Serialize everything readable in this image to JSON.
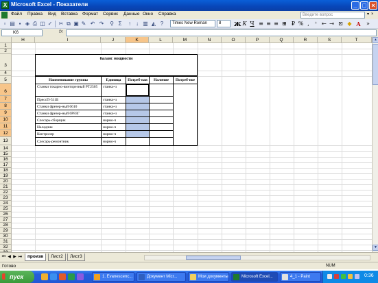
{
  "window": {
    "title": "Microsoft Excel - Показатели"
  },
  "menu": {
    "items": [
      "Файл",
      "Правка",
      "Вид",
      "Вставка",
      "Формат",
      "Сервис",
      "Данные",
      "Окно",
      "Справка"
    ],
    "help_placeholder": "Введите вопрос"
  },
  "toolbar": {
    "font": "Times New Roman",
    "size": "8"
  },
  "formula_bar": {
    "name_box": "K6",
    "fx": "fx",
    "formula": ""
  },
  "grid": {
    "columns": [
      "H",
      "I",
      "J",
      "K",
      "L",
      "M",
      "N",
      "O",
      "P",
      "Q",
      "R",
      "S",
      "T"
    ],
    "selected_column": "K",
    "rows": [
      "1",
      "2",
      "3",
      "4",
      "5",
      "6",
      "7",
      "8",
      "9",
      "10",
      "11",
      "12",
      "13",
      "14",
      "15",
      "16",
      "17",
      "18",
      "19",
      "20",
      "21",
      "22",
      "23",
      "24",
      "25",
      "26",
      "27",
      "28",
      "29",
      "30",
      "31",
      "32",
      "33",
      "34"
    ],
    "selected_rows": [
      "6",
      "7",
      "8",
      "9",
      "10",
      "11",
      "12"
    ]
  },
  "table": {
    "title": "баланс мощности",
    "headers": [
      "Наименование группы",
      "Единица",
      "Потреб-ная",
      "Наличие",
      "Потреб-ное"
    ],
    "rows": [
      {
        "name": "Станки токарно-винторезный РТ2505",
        "unit": "станко-ч"
      },
      {
        "name": "ПрессП-511Б",
        "unit": "станко-ч"
      },
      {
        "name": "Станки фрезер-ный 6610",
        "unit": "станко-ч"
      },
      {
        "name": "Станки фрезер-ный 6Р83Г",
        "unit": "станко-ч"
      },
      {
        "name": "Слесарь-сборщик",
        "unit": "нормо-ч"
      },
      {
        "name": "Наладчик",
        "unit": "нормо-ч"
      },
      {
        "name": "Контролер",
        "unit": "нормо-ч"
      },
      {
        "name": "Слесарь-ремонтник",
        "unit": "нормо-ч"
      }
    ]
  },
  "sheet_tabs": {
    "tabs": [
      "произв",
      "Лист2",
      "Лист3"
    ],
    "active": "произв"
  },
  "status": {
    "text": "Готово",
    "num": "NUM"
  },
  "taskbar": {
    "start": "пуск",
    "tasks": [
      "1. Evanescenc...",
      "Документ Micr...",
      "Мои документы",
      "Microsoft Excel...",
      "4_1 - Paint"
    ],
    "active_task": "Microsoft Excel...",
    "clock": "0:36"
  },
  "colors": {
    "titlebar": "#0846b8",
    "selected_header": "#f7c58a",
    "highlight_cell": "#b6c8e8",
    "taskbar": "#245edb",
    "start": "#3a9a3a"
  }
}
